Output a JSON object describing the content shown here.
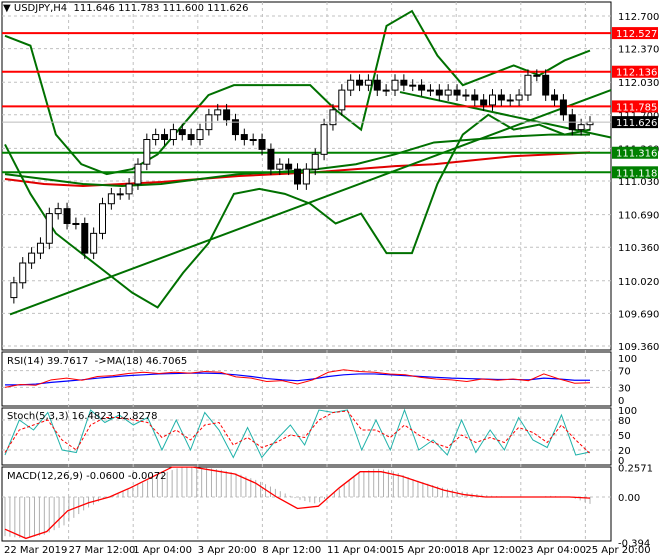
{
  "chart_data": {
    "type": "candlestick",
    "symbol": "USDJPY,H4",
    "ohlc_label": "111.646 111.783 111.600 111.626",
    "price_ticks": [
      "112.700",
      "112.370",
      "112.030",
      "111.700",
      "111.360",
      "111.030",
      "110.690",
      "110.360",
      "110.020",
      "109.690",
      "109.360"
    ],
    "ylim": [
      109.36,
      112.7
    ],
    "levels": [
      {
        "label": "112.527",
        "value": 112.527,
        "color": "#ff0000"
      },
      {
        "label": "112.136",
        "value": 112.136,
        "color": "#ff0000"
      },
      {
        "label": "111.785",
        "value": 111.785,
        "color": "#ff0000"
      },
      {
        "label": "111.316",
        "value": 111.316,
        "color": "#008000"
      },
      {
        "label": "111.118",
        "value": 111.118,
        "color": "#008000"
      }
    ],
    "current_price": {
      "label": "111.626",
      "value": 111.626
    },
    "close": [
      109.85,
      110.0,
      110.2,
      110.3,
      110.4,
      110.7,
      110.75,
      110.6,
      110.6,
      110.3,
      110.5,
      110.8,
      110.9,
      110.9,
      111.0,
      111.2,
      111.45,
      111.5,
      111.45,
      111.55,
      111.5,
      111.45,
      111.55,
      111.7,
      111.75,
      111.65,
      111.5,
      111.45,
      111.45,
      111.35,
      111.15,
      111.2,
      111.15,
      111.0,
      111.15,
      111.3,
      111.6,
      111.75,
      111.95,
      112.05,
      112.0,
      112.05,
      111.95,
      111.95,
      112.05,
      112.0,
      112.0,
      111.95,
      111.95,
      111.9,
      111.95,
      111.9,
      111.9,
      111.85,
      111.8,
      111.9,
      111.85,
      111.85,
      111.9,
      112.1,
      112.1,
      111.9,
      111.85,
      111.7,
      111.55,
      111.6,
      111.626
    ],
    "bb_upper": [
      112.5,
      112.4,
      111.5,
      111.2,
      111.1,
      111.15,
      111.3,
      111.6,
      111.9,
      112.0,
      112.0,
      112.0,
      112.0,
      111.75,
      111.55,
      112.6,
      112.75,
      112.3,
      112.0,
      112.1,
      112.2,
      112.1,
      112.25,
      112.35
    ],
    "bb_lower": [
      111.4,
      110.9,
      110.5,
      110.3,
      110.1,
      109.9,
      109.75,
      110.1,
      110.4,
      110.9,
      110.95,
      110.9,
      110.8,
      110.6,
      110.7,
      110.3,
      110.3,
      111.0,
      111.5,
      111.7,
      111.55,
      111.6,
      111.5,
      111.55
    ],
    "ma200": [
      111.05,
      111.0,
      110.98,
      111.0,
      111.02,
      111.05,
      111.08,
      111.1,
      111.12,
      111.15,
      111.18,
      111.2,
      111.24,
      111.28,
      111.3,
      111.32
    ],
    "ma_green": [
      111.1,
      111.05,
      111.0,
      110.98,
      111.0,
      111.05,
      111.1,
      111.12,
      111.15,
      111.2,
      111.3,
      111.42,
      111.45,
      111.48,
      111.5,
      111.5
    ],
    "trendlines": [
      {
        "from": 109.68,
        "to": 111.95
      },
      {
        "from": 111.93,
        "to": 111.47
      }
    ],
    "time_labels": [
      "22 Mar 2019",
      "27 Mar 12:00",
      "1 Apr 04:00",
      "3 Apr 20:00",
      "8 Apr 12:00",
      "11 Apr 04:00",
      "15 Apr 20:00",
      "18 Apr 12:00",
      "23 Apr 04:00",
      "25 Apr 20:00"
    ],
    "rsi": {
      "label": "RSI(14) 39.7617  ->MA(18) 46.7065",
      "ticks": [
        "100",
        "70",
        "30",
        "0"
      ],
      "values": [
        30,
        37,
        35,
        48,
        52,
        47,
        56,
        58,
        63,
        66,
        63,
        66,
        64,
        68,
        66,
        55,
        52,
        44,
        46,
        38,
        48,
        66,
        72,
        68,
        66,
        62,
        60,
        54,
        50,
        48,
        44,
        50,
        47,
        50,
        46,
        62,
        50,
        40,
        41
      ],
      "ma": [
        36,
        36,
        38,
        42,
        45,
        48,
        52,
        55,
        58,
        60,
        62,
        63,
        64,
        64,
        63,
        60,
        56,
        51,
        48,
        46,
        50,
        56,
        60,
        62,
        62,
        60,
        58,
        56,
        54,
        52,
        51,
        50,
        49,
        49,
        48,
        52,
        50,
        47,
        47
      ]
    },
    "stoch": {
      "label": "Stoch(5,3,3) 16.4823 12.8278",
      "ticks": [
        "100",
        "80",
        "50",
        "20",
        "0"
      ],
      "k": [
        10,
        80,
        60,
        95,
        20,
        15,
        100,
        75,
        90,
        70,
        85,
        20,
        80,
        20,
        95,
        60,
        5,
        65,
        5,
        40,
        70,
        30,
        100,
        95,
        100,
        20,
        80,
        20,
        100,
        20,
        40,
        10,
        80,
        15,
        60,
        20,
        85,
        40,
        25,
        90,
        10,
        16
      ],
      "d": [
        15,
        60,
        70,
        80,
        40,
        20,
        70,
        85,
        85,
        80,
        75,
        45,
        60,
        40,
        70,
        75,
        30,
        45,
        25,
        35,
        50,
        45,
        80,
        95,
        98,
        60,
        60,
        45,
        70,
        50,
        35,
        25,
        50,
        35,
        45,
        35,
        65,
        55,
        35,
        70,
        40,
        13
      ]
    },
    "macd": {
      "label": "MACD(12,26,9) -0.0600 -0.0072",
      "ticks": [
        "0.2571",
        "0.00",
        "-0.394"
      ],
      "hist": [
        -0.34,
        -0.36,
        -0.33,
        -0.25,
        -0.12,
        -0.02,
        0.05,
        0.12,
        0.2,
        0.26,
        0.26,
        0.24,
        0.2,
        0.14,
        0.06,
        -0.02,
        -0.06,
        0.05,
        0.2,
        0.25,
        0.22,
        0.15,
        0.1,
        0.06,
        0.03,
        0.01,
        0.0,
        0.0,
        0.01,
        0.0,
        -0.06
      ],
      "signal": [
        -0.28,
        -0.36,
        -0.3,
        -0.12,
        -0.05,
        0.0,
        0.08,
        0.17,
        0.26,
        0.26,
        0.23,
        0.2,
        0.12,
        0.0,
        -0.1,
        -0.08,
        0.08,
        0.22,
        0.22,
        0.18,
        0.12,
        0.06,
        0.02,
        0.0,
        0.0,
        0.0,
        0.0,
        0.0,
        -0.01
      ]
    }
  }
}
